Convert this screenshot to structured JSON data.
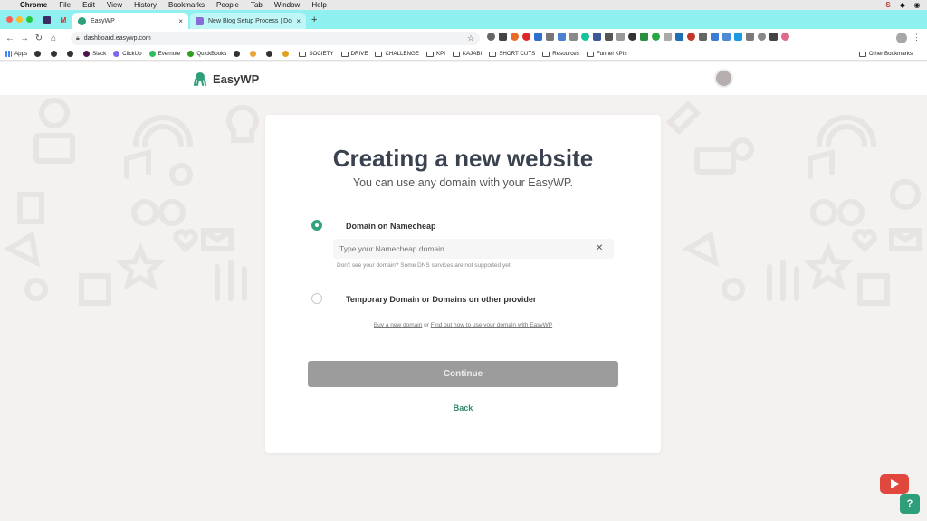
{
  "os_menubar": {
    "items": [
      "Chrome",
      "File",
      "Edit",
      "View",
      "History",
      "Bookmarks",
      "People",
      "Tab",
      "Window",
      "Help"
    ]
  },
  "browser": {
    "tabs": [
      {
        "title": "EasyWP",
        "active": true,
        "favicon_color": "#2f9f7b"
      },
      {
        "title": "New Blog Setup Process | Doc",
        "active": false,
        "favicon_color": "#8a6cd6"
      }
    ],
    "address": "dashboard.easywp.com",
    "bookmarks": [
      {
        "label": "Apps",
        "kind": "grid"
      },
      {
        "label": "",
        "kind": "dot"
      },
      {
        "label": "",
        "kind": "dot"
      },
      {
        "label": "",
        "kind": "dot"
      },
      {
        "label": "Slack",
        "kind": "dot"
      },
      {
        "label": "ClickUp",
        "kind": "dot"
      },
      {
        "label": "Evernote",
        "kind": "dot"
      },
      {
        "label": "QuickBooks",
        "kind": "dot"
      },
      {
        "label": "",
        "kind": "dot"
      },
      {
        "label": "",
        "kind": "dot"
      },
      {
        "label": "",
        "kind": "dot"
      },
      {
        "label": "",
        "kind": "dot"
      },
      {
        "label": "SOCIETY",
        "kind": "folder"
      },
      {
        "label": "DRIVE",
        "kind": "folder"
      },
      {
        "label": "CHALLENGE",
        "kind": "folder"
      },
      {
        "label": "KPI",
        "kind": "folder"
      },
      {
        "label": "KAJABI",
        "kind": "folder"
      },
      {
        "label": "SHORT CUTS",
        "kind": "folder"
      },
      {
        "label": "Resources",
        "kind": "folder"
      },
      {
        "label": "Funnel KPIs",
        "kind": "folder"
      }
    ],
    "other_bookmarks": "Other Bookmarks"
  },
  "app": {
    "name": "EasyWP",
    "brand_color": "#2f9f7b"
  },
  "card": {
    "title": "Creating a new website",
    "subtitle": "You can use any domain with your EasyWP.",
    "option1_label": "Domain on Namecheap",
    "option1_selected": true,
    "domain_placeholder": "Type your Namecheap domain...",
    "hint": "Don't see your domain? Some DNS services are not supported yet.",
    "option2_label": "Temporary Domain or Domains on other provider",
    "option2_selected": false,
    "link_buy": "Buy a new domain",
    "link_or": " or ",
    "link_findout": "Find out how to use your domain with EasyWP",
    "continue_label": "Continue",
    "back_label": "Back"
  },
  "help_label": "?"
}
